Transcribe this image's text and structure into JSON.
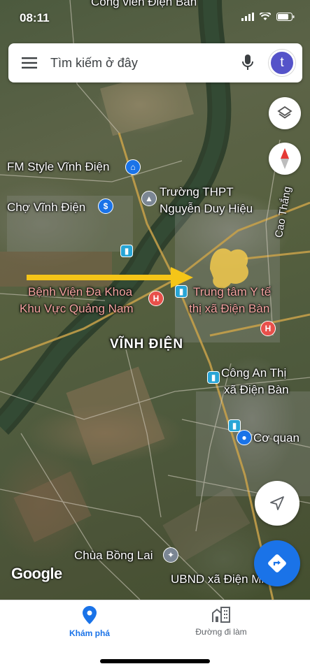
{
  "status_bar": {
    "time": "08:11"
  },
  "search": {
    "placeholder": "Tìm kiếm ở đây",
    "avatar_initial": "t"
  },
  "map": {
    "top_cut_label": "Công viên Điện Bàn",
    "labels": {
      "fm_style": "FM Style Vĩnh Điện",
      "cho": "Chợ Vĩnh Điện",
      "truong_line1": "Trường THPT",
      "truong_line2": "Nguyễn Duy Hiệu",
      "cao_thang": "Cao Thắng",
      "benh_vien_line1": "Bệnh Viện Đa Khoa",
      "benh_vien_line2": "Khu Vực Quảng Nam",
      "trung_tam_line1": "Trung tâm Y tế",
      "trung_tam_line2": "thị xã Điện Bàn",
      "district": "VĨNH ĐIỆN",
      "cong_an_line1": "Công An Thị",
      "cong_an_line2": "xã Điện Bàn",
      "co_quan": "Cơ quan",
      "chua": "Chùa Bồng Lai",
      "ubnd": "UBND xã Điện Minh"
    },
    "logo": "Google"
  },
  "colors": {
    "accent": "#1a73e8",
    "arrow": "#f5c518",
    "highlight": "#f2c94c",
    "hospital_label": "#f4a3a0",
    "avatar_bg": "#5553c9"
  },
  "icons": [
    "menu-icon",
    "mic-icon",
    "layers-icon",
    "compass-icon",
    "location-arrow-icon",
    "directions-icon",
    "explore-pin-icon",
    "commute-building-icon",
    "shopping-bag-icon",
    "cart-icon",
    "school-icon",
    "hospital-icon",
    "bus-icon",
    "temple-icon"
  ],
  "bottom_nav": {
    "explore_label": "Khám phá",
    "commute_label": "Đường đi làm"
  }
}
